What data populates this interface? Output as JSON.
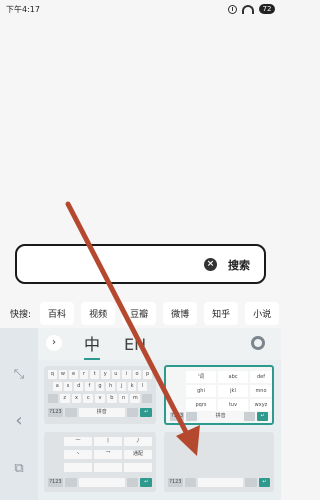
{
  "status_bar": {
    "time": "下午4:17",
    "battery": "72"
  },
  "search": {
    "value": "",
    "clear_icon": "×",
    "button_label": "搜索"
  },
  "quick_bar": {
    "label": "快搜:",
    "items": [
      "百科",
      "视频",
      "豆瓣",
      "微博",
      "知乎",
      "小说"
    ]
  },
  "keyboard": {
    "tabs": {
      "chinese": "中",
      "english": "EN"
    },
    "collapse_glyph": "›",
    "qwerty_rows": [
      [
        "q",
        "w",
        "e",
        "r",
        "t",
        "y",
        "u",
        "i",
        "o",
        "p"
      ],
      [
        "a",
        "s",
        "d",
        "f",
        "g",
        "h",
        "j",
        "k",
        "l"
      ],
      [
        "z",
        "x",
        "c",
        "v",
        "b",
        "n",
        "m"
      ]
    ],
    "qwerty_bottom": {
      "sym": "?123",
      "space": "拼音"
    },
    "t9": {
      "keys": [
        "'词",
        "abc",
        "def",
        "ghi",
        "jkl",
        "mno",
        "pqrs",
        "tuv",
        "wxyz"
      ],
      "sym": "?123",
      "space": "拼音"
    },
    "stroke": {
      "sym": "?123",
      "label": "通配"
    },
    "handwrite": {
      "sym": "?123"
    }
  },
  "colors": {
    "accent": "#2e9a8e",
    "arrow": "#b5492f"
  }
}
